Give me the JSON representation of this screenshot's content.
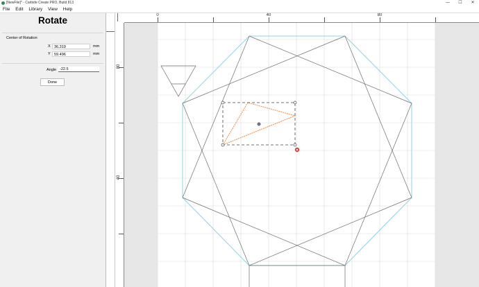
{
  "window": {
    "title": "[NewFile]* - Carbide Create PRO, Build 813",
    "minimize": "—",
    "maximize": "☐",
    "close": "✕"
  },
  "menu": [
    "File",
    "Edit",
    "Library",
    "View",
    "Help"
  ],
  "panel": {
    "title": "Rotate",
    "section_label": "Center of Rotation",
    "x_label": "X",
    "x_value": "36.319",
    "x_unit": "mm",
    "y_label": "Y",
    "y_value": "59.496",
    "y_unit": "mm",
    "angle_label": "Angle",
    "angle_value": "-22.5",
    "done_label": "Done"
  },
  "rulers": {
    "horizontal_labels": [
      "0",
      "40",
      "80"
    ],
    "vertical_labels": [
      "80",
      "40"
    ]
  },
  "colors": {
    "selected_path": "#f07d2a",
    "boundary": "#8fd3e6",
    "shape": "#6e6e6e",
    "grid": "#d6d6d6",
    "marker": "#e53935"
  }
}
